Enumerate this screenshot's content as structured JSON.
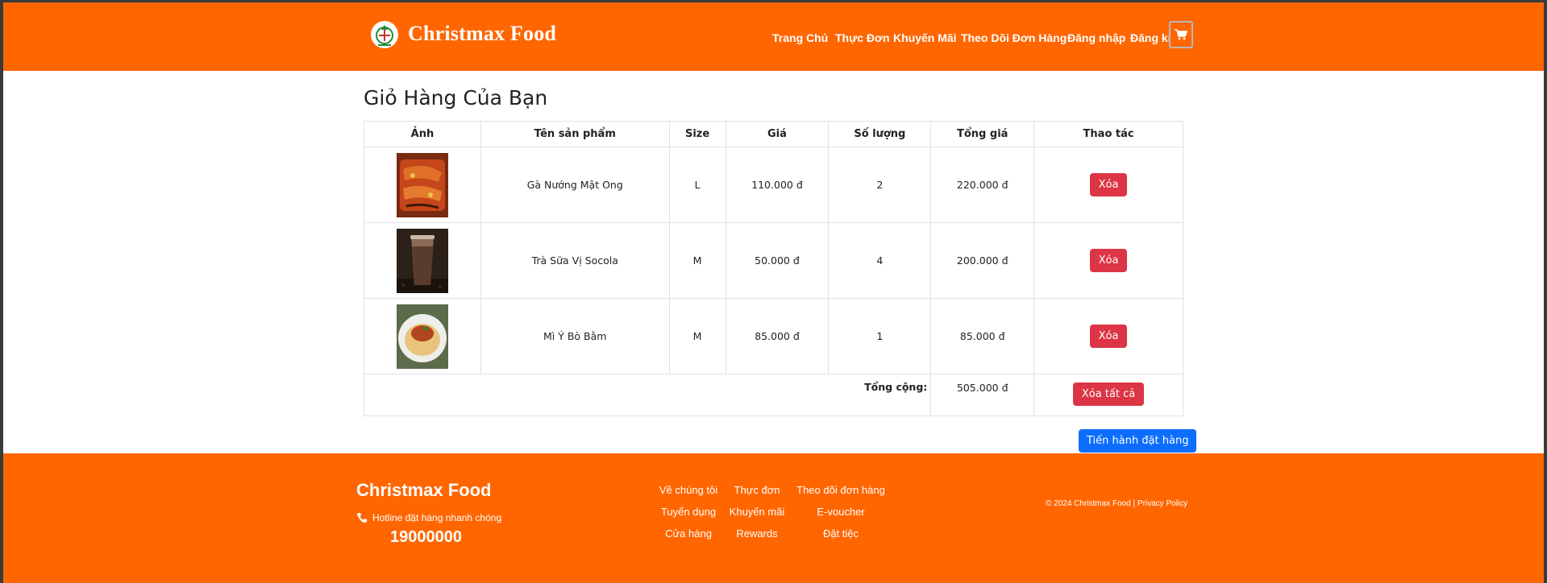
{
  "header": {
    "brand": "Christmax Food",
    "nav": [
      "Trang Chủ",
      "Thực Đơn",
      "Khuyến Mãi",
      "Theo Dõi Đơn Hàng",
      "Đăng nhập",
      "Đăng kí"
    ]
  },
  "main": {
    "title": "Giỏ Hàng Của Bạn",
    "columns": [
      "Ảnh",
      "Tên sản phẩm",
      "Size",
      "Giá",
      "Số lượng",
      "Tổng giá",
      "Thao tác"
    ],
    "items": [
      {
        "name": "Gà Nướng Mật Ong",
        "size": "L",
        "price": "110.000 đ",
        "qty": "2",
        "total": "220.000 đ",
        "action": "Xóa",
        "image": "honey-grilled-chicken"
      },
      {
        "name": "Trà Sữa Vị Socola",
        "size": "M",
        "price": "50.000 đ",
        "qty": "4",
        "total": "200.000 đ",
        "action": "Xóa",
        "image": "chocolate-milk-tea"
      },
      {
        "name": "Mì Ý Bò Bằm",
        "size": "M",
        "price": "85.000 đ",
        "qty": "1",
        "total": "85.000 đ",
        "action": "Xóa",
        "image": "beef-spaghetti"
      }
    ],
    "total_label": "Tổng cộng:",
    "total_value": "505.000 đ",
    "delete_all": "Xóa tất cả",
    "checkout": "Tiến hành đặt hàng"
  },
  "footer": {
    "brand": "Christmax Food",
    "hotline_label": "Hotline đặt hàng nhanh chóng",
    "phone": "19000000",
    "links": [
      [
        "Về chúng tôi",
        "Thực đơn",
        "Theo dõi đơn hàng"
      ],
      [
        "Tuyển dụng",
        "Khuyến mãi",
        "E-voucher"
      ],
      [
        "Cửa hàng",
        "Rewards",
        "Đặt tiệc"
      ]
    ],
    "copyright": "© 2024 Christmax Food | Privacy Policy"
  },
  "colors": {
    "primary": "#ff6600",
    "danger": "#dc3545",
    "action": "#0d6efd"
  }
}
